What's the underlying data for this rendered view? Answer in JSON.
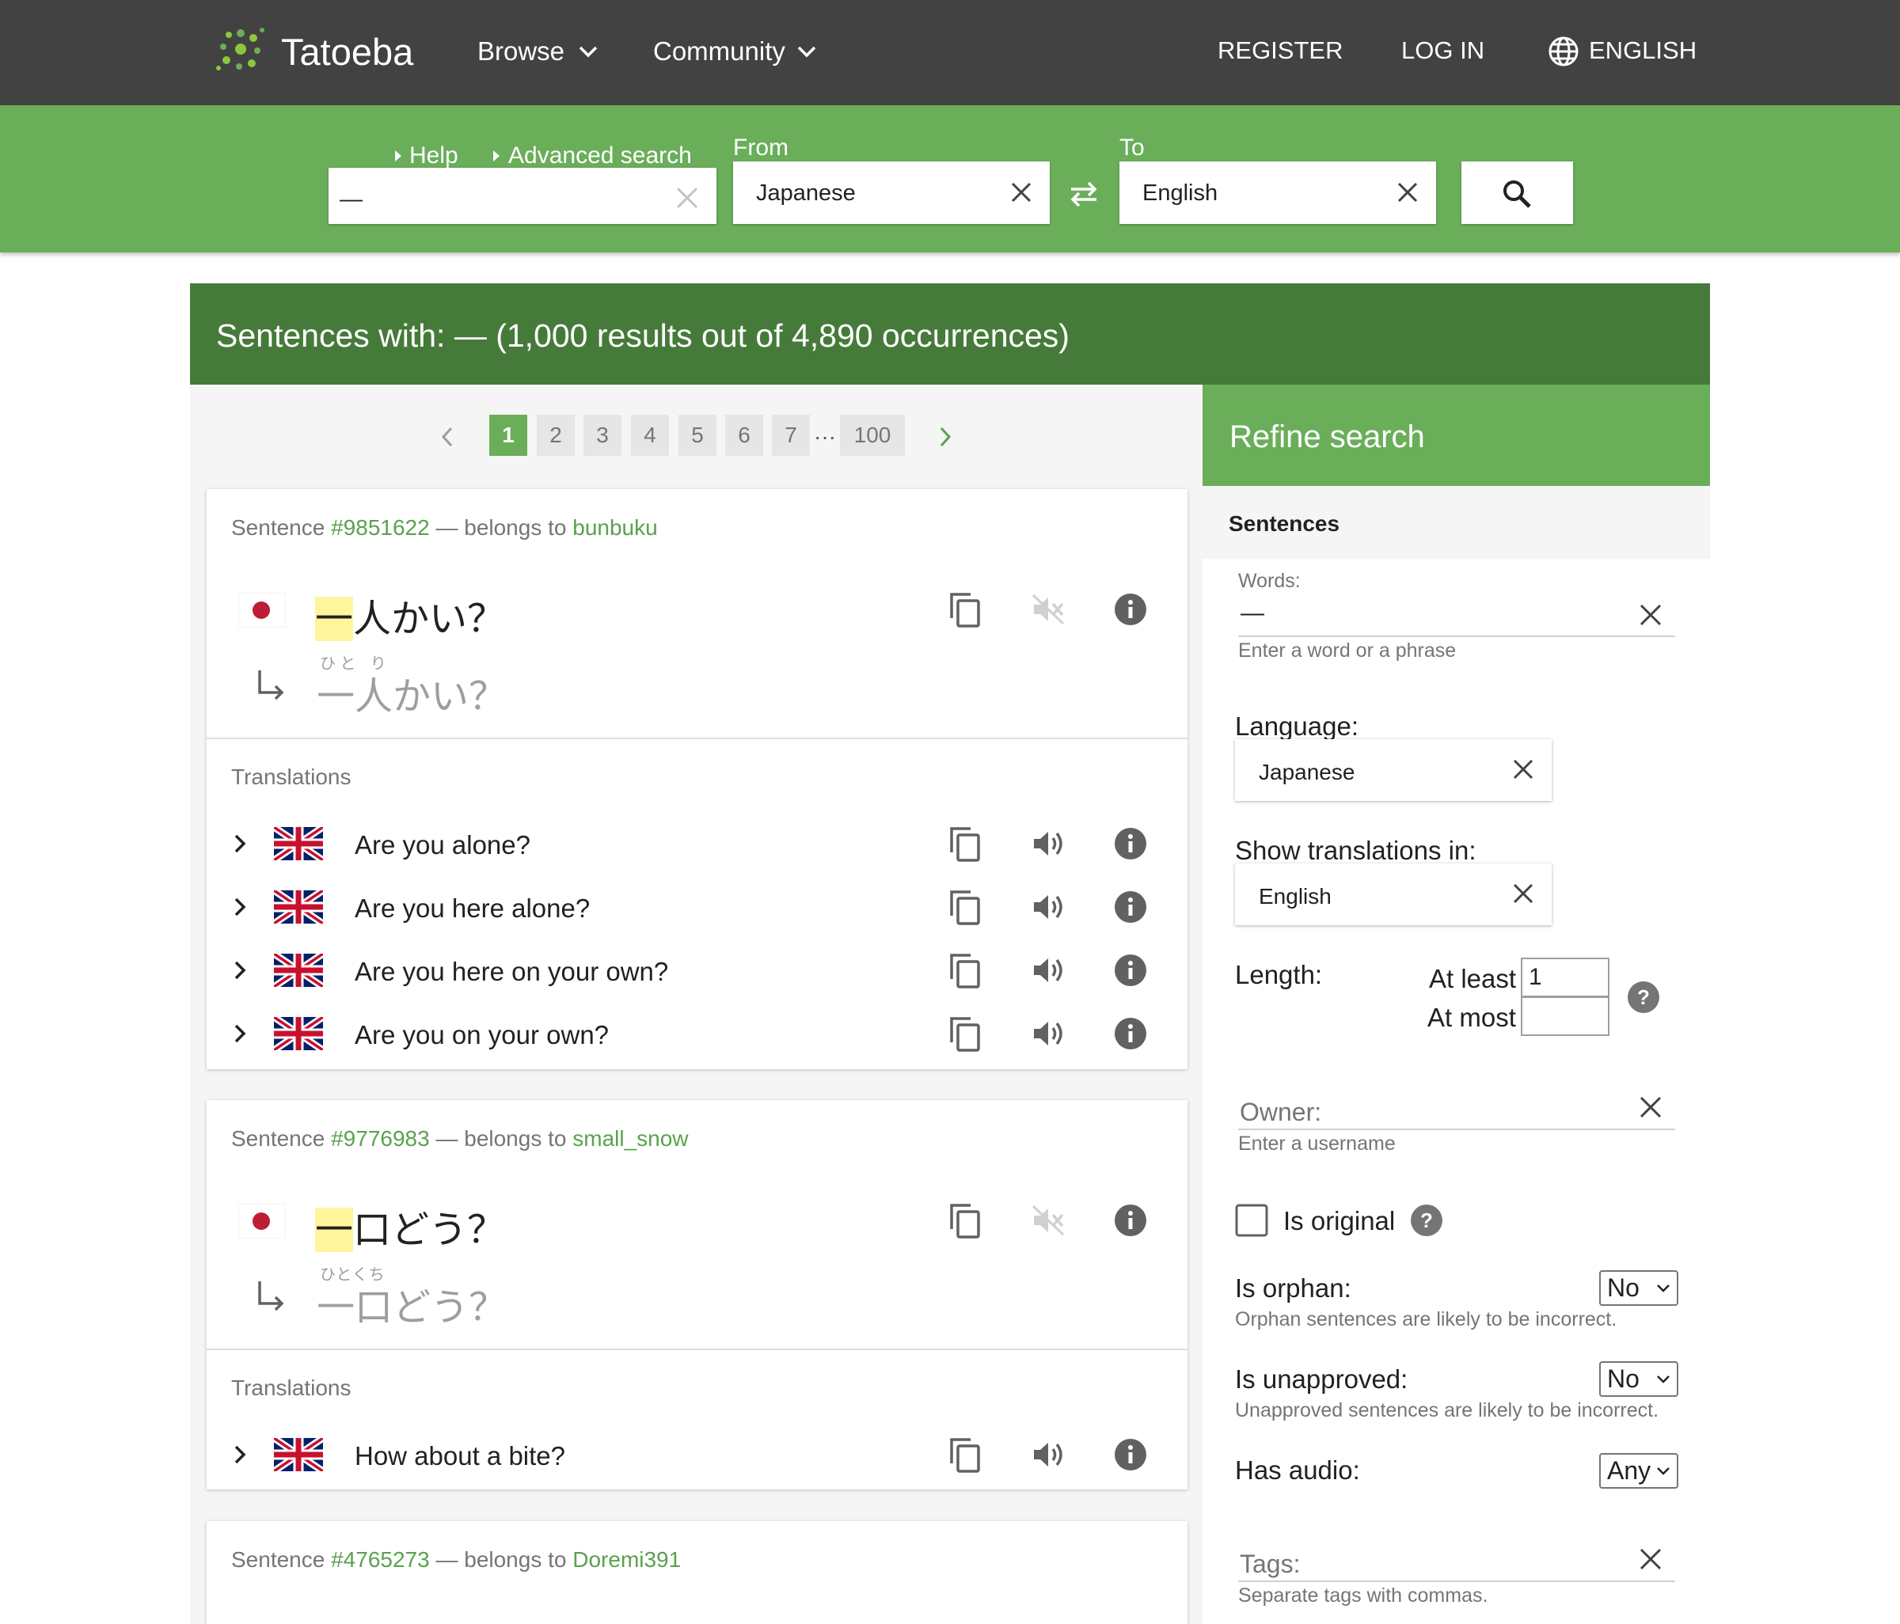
{
  "nav": {
    "brand": "Tatoeba",
    "browse": "Browse",
    "community": "Community",
    "register": "REGISTER",
    "login": "LOG IN",
    "language": "ENGLISH"
  },
  "search": {
    "help": "Help",
    "advanced": "Advanced search",
    "query": "—",
    "from_label": "From",
    "from_value": "Japanese",
    "to_label": "To",
    "to_value": "English"
  },
  "results": {
    "title": "Sentences with: — (1,000 results out of 4,890 occurrences)"
  },
  "pagination": {
    "pages": [
      "1",
      "2",
      "3",
      "4",
      "5",
      "6",
      "7"
    ],
    "ellipsis": "···",
    "last": "100",
    "current": "1"
  },
  "cards": [
    {
      "prefix": "Sentence",
      "id": "#9851622",
      "belongs": "— belongs to",
      "owner": "bunbuku",
      "hl": "一",
      "rest": "人かい？",
      "furigana": "ひと り",
      "reading": "一人かい？",
      "translations_title": "Translations",
      "translations": [
        "Are you alone?",
        "Are you here alone?",
        "Are you here on your own?",
        "Are you on your own?"
      ]
    },
    {
      "prefix": "Sentence",
      "id": "#9776983",
      "belongs": "— belongs to",
      "owner": "small_snow",
      "hl": "一",
      "rest": "口どう？",
      "furigana": "ひとくち",
      "reading": "一口どう？",
      "translations_title": "Translations",
      "translations": [
        "How about a bite?"
      ]
    },
    {
      "prefix": "Sentence",
      "id": "#4765273",
      "belongs": "— belongs to",
      "owner": "Doremi391"
    }
  ],
  "refine": {
    "title": "Refine search",
    "section": "Sentences",
    "words_label": "Words:",
    "words_value": "—",
    "words_hint": "Enter a word or a phrase",
    "language_label": "Language:",
    "language_value": "Japanese",
    "show_translations_label": "Show translations in:",
    "show_translations_value": "English",
    "length_label": "Length:",
    "at_least_label": "At least",
    "at_least_value": "1",
    "at_most_label": "At most",
    "at_most_value": "",
    "owner_placeholder": "Owner:",
    "owner_hint": "Enter a username",
    "is_original_label": "Is original",
    "is_orphan_label": "Is orphan:",
    "is_orphan_value": "No",
    "orphan_hint": "Orphan sentences are likely to be incorrect.",
    "is_unapproved_label": "Is unapproved:",
    "is_unapproved_value": "No",
    "unapproved_hint": "Unapproved sentences are likely to be incorrect.",
    "has_audio_label": "Has audio:",
    "has_audio_value": "Any",
    "tags_placeholder": "Tags:",
    "tags_hint": "Separate tags with commas."
  },
  "colors": {
    "topbar": "#424242",
    "green": "#6aae5a",
    "dark_green": "#467a3a",
    "link_green": "#5aa14e",
    "highlight": "#fff59d"
  },
  "icons": [
    "logo-icon",
    "chevron-down-icon",
    "globe-icon",
    "triangle-right-icon",
    "close-icon",
    "swap-icon",
    "search-icon",
    "chevron-left-icon",
    "chevron-right-icon",
    "japan-flag-icon",
    "uk-flag-icon",
    "return-arrow-icon",
    "copy-icon",
    "audio-icon",
    "audio-off-icon",
    "info-icon",
    "help-icon",
    "checkbox-icon"
  ]
}
